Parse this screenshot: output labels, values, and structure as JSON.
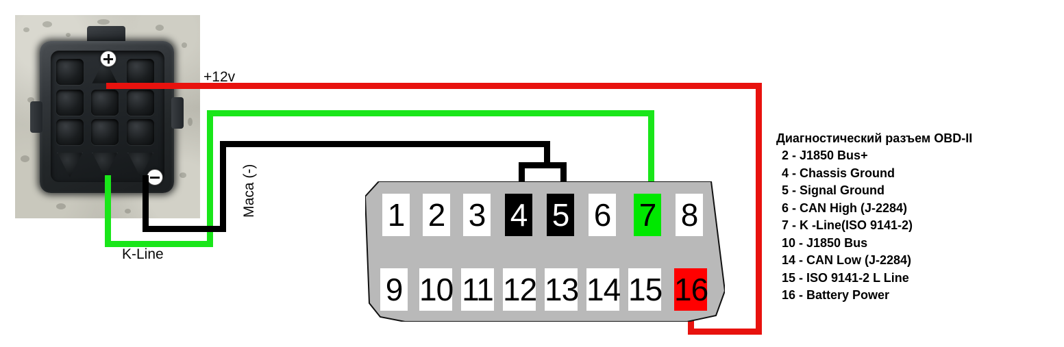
{
  "diagram": {
    "title_hidden": "OBD-II adapter wiring diagram",
    "photo": {
      "name": "vehicle-diagnostic-connector-photo",
      "plus_symbol": "plus-sign",
      "minus_symbol": "minus-sign"
    },
    "wire_labels": {
      "power": "+12v",
      "ground": "Маса (-)",
      "kline": "K-Line"
    },
    "obd_connector": {
      "top_row": [
        {
          "num": "1",
          "state": "normal"
        },
        {
          "num": "2",
          "state": "normal"
        },
        {
          "num": "3",
          "state": "normal"
        },
        {
          "num": "4",
          "state": "dark"
        },
        {
          "num": "5",
          "state": "dark"
        },
        {
          "num": "6",
          "state": "normal"
        },
        {
          "num": "7",
          "state": "green"
        },
        {
          "num": "8",
          "state": "normal"
        }
      ],
      "bottom_row": [
        {
          "num": "9",
          "state": "normal"
        },
        {
          "num": "10",
          "state": "normal"
        },
        {
          "num": "11",
          "state": "normal"
        },
        {
          "num": "12",
          "state": "normal"
        },
        {
          "num": "13",
          "state": "normal"
        },
        {
          "num": "14",
          "state": "normal"
        },
        {
          "num": "15",
          "state": "normal"
        },
        {
          "num": "16",
          "state": "red"
        }
      ]
    },
    "legend": {
      "title": "Диагностический разъем OBD-II",
      "items": [
        "2 - J1850 Bus+",
        "4 - Chassis Ground",
        "5 - Signal Ground",
        "6 - CAN High (J-2284)",
        "7 -  K -Line(ISO 9141-2)",
        "10 - J1850 Bus",
        "14 - CAN Low (J-2284)",
        "15 - ISO 9141-2 L Line",
        "16 - Battery Power"
      ]
    },
    "colors": {
      "power_wire": "#e8120e",
      "kline_wire": "#19e619",
      "ground_wire": "#000000",
      "connector_body": "#b9b9b9",
      "pin_green": "#00e800",
      "pin_red": "#ff0000"
    }
  }
}
